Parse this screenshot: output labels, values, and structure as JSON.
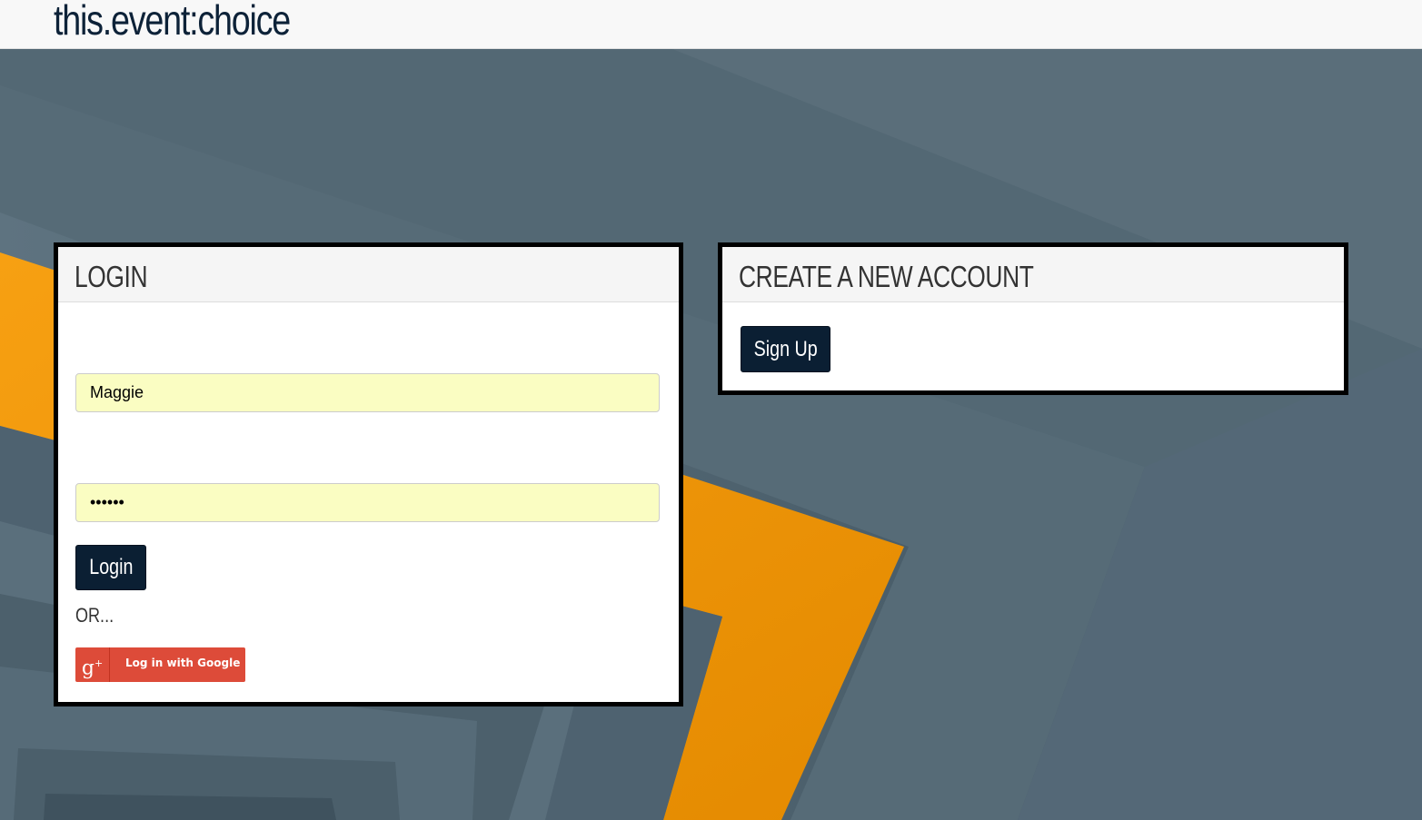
{
  "header": {
    "brand": "this.event:choice"
  },
  "login_panel": {
    "title": "LOGIN",
    "username_value": "Maggie",
    "password_value": "••••••",
    "login_button": "Login",
    "or_text": "OR...",
    "google_button": "Log in with Google",
    "google_icon_glyph": "g",
    "google_icon_sup": "+"
  },
  "signup_panel": {
    "title": "CREATE A NEW ACCOUNT",
    "signup_button": "Sign Up"
  },
  "colors": {
    "accent_dark": "#0b1f33",
    "google_red": "#dd4b39",
    "background_slate": "#4f636f",
    "background_orange": "#f39200",
    "autofill_yellow": "#fafdc2"
  },
  "icons": {
    "google_plus": "google-plus-icon"
  }
}
